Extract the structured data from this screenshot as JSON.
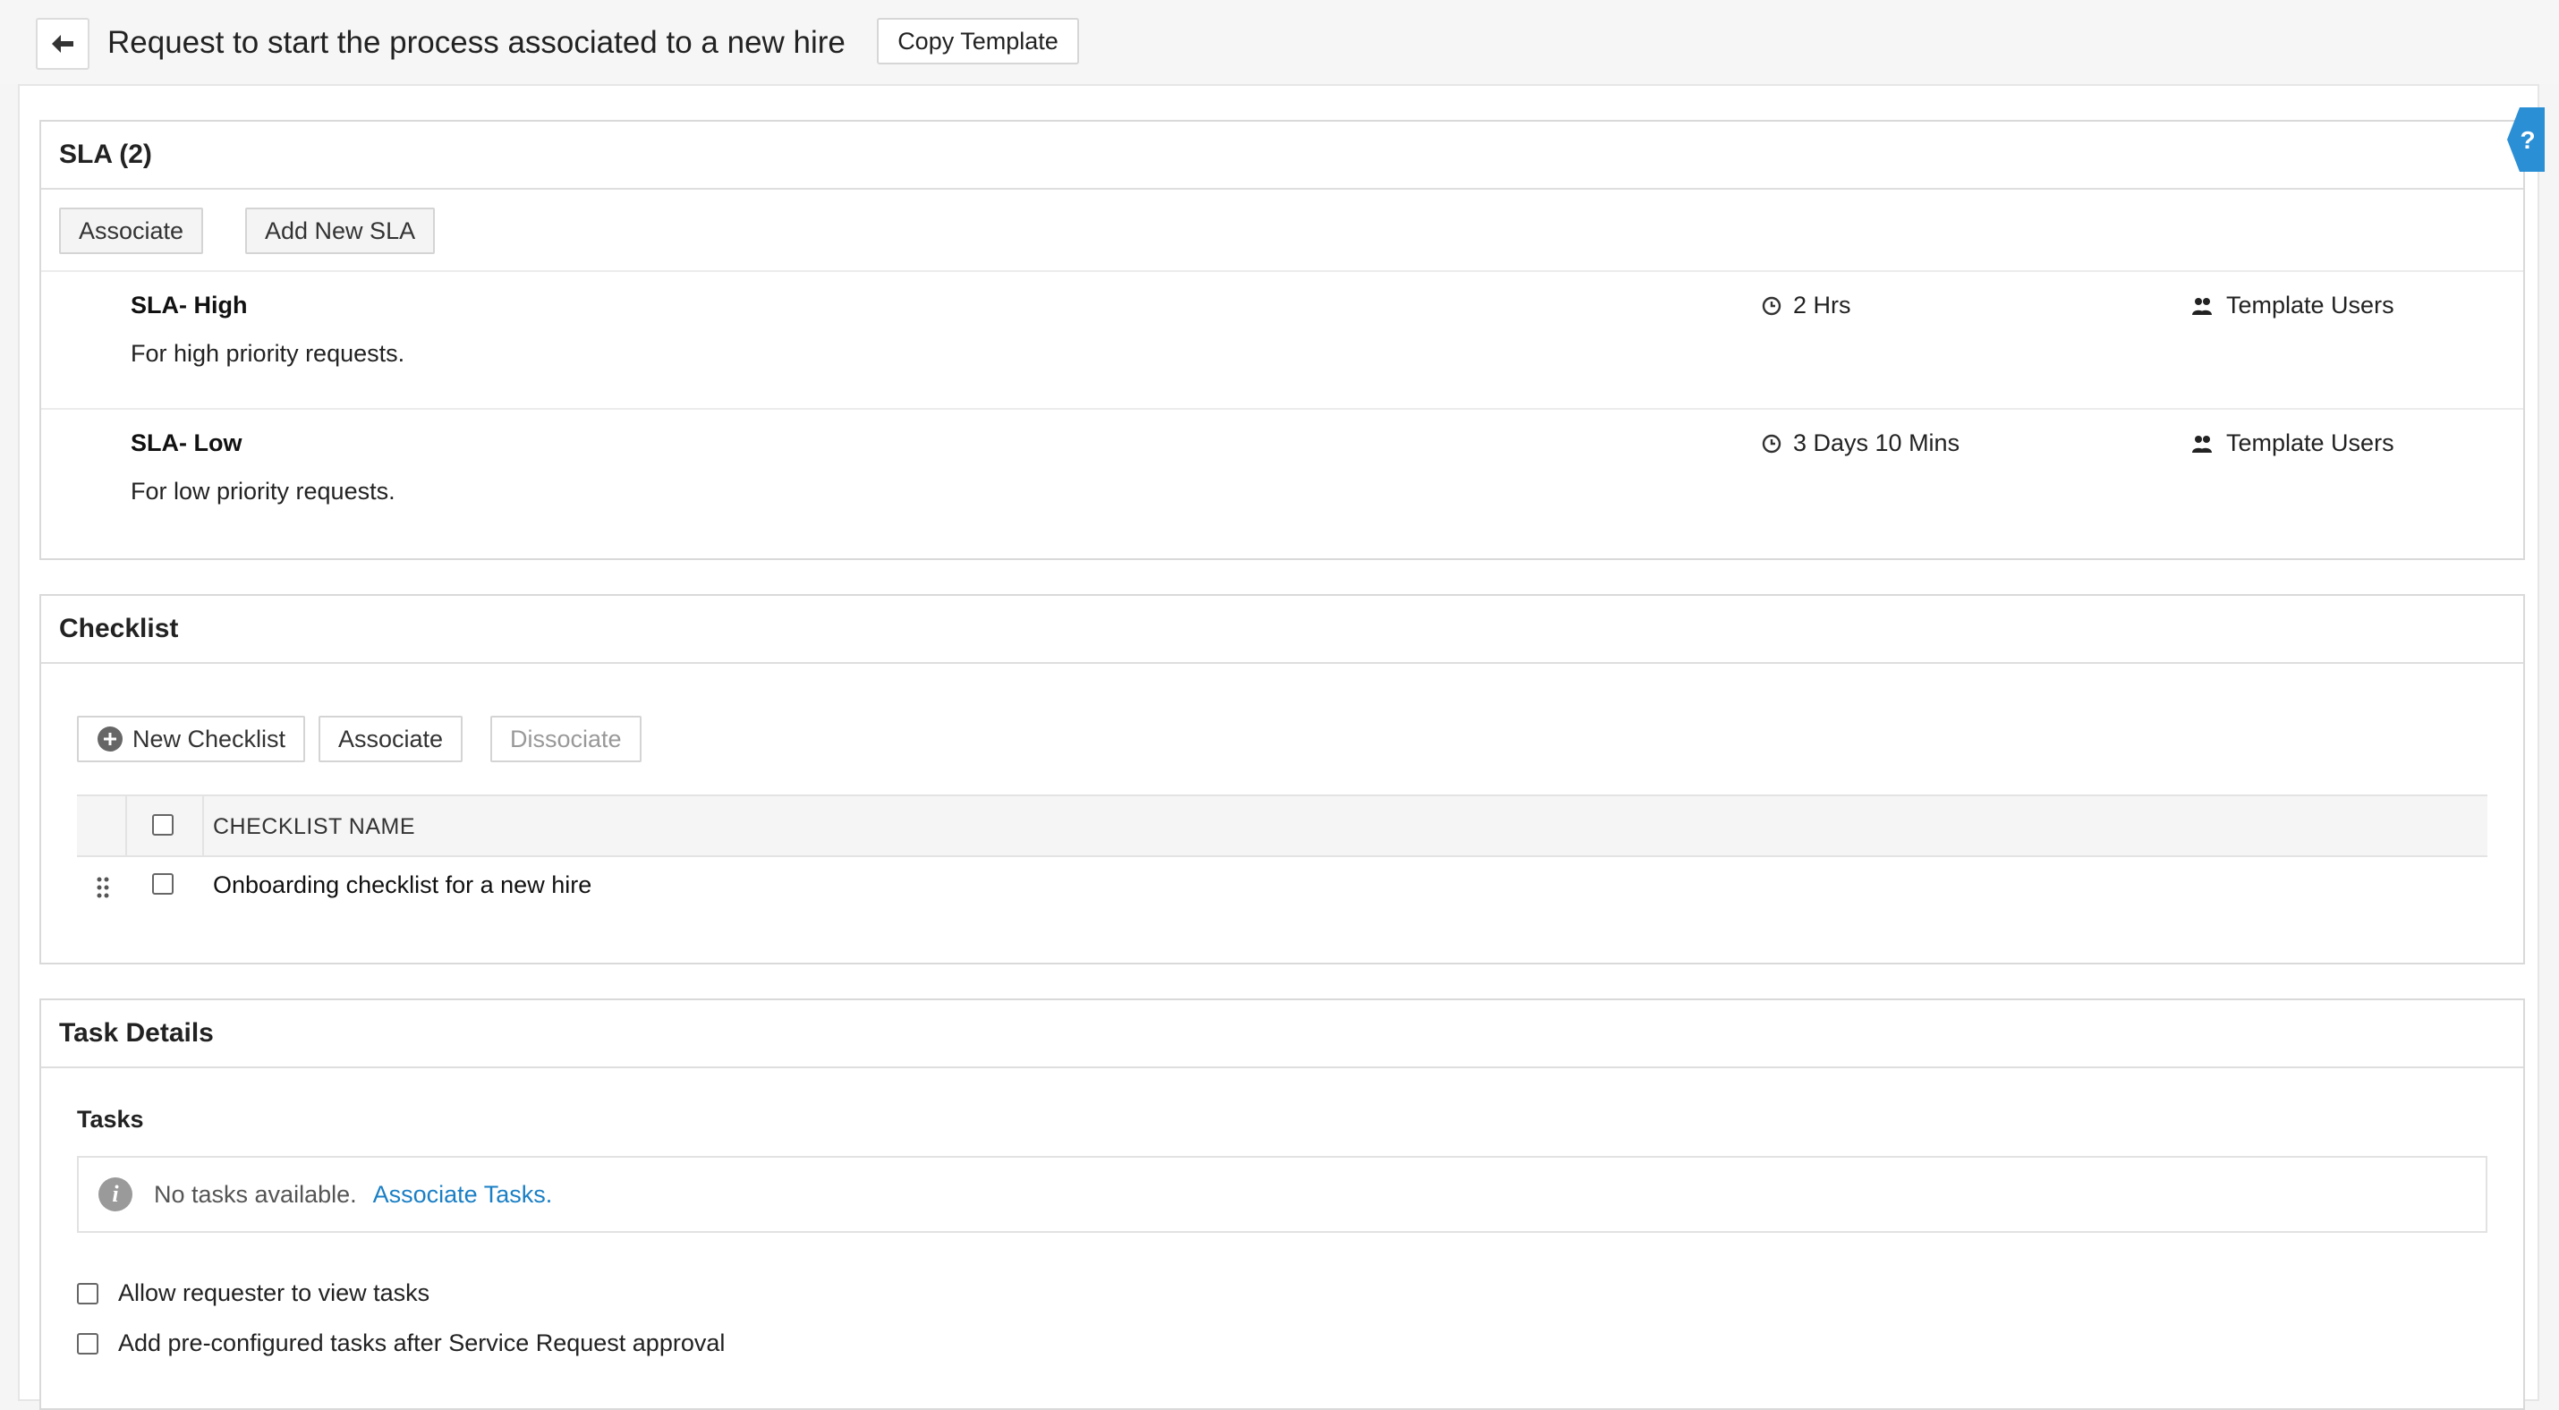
{
  "header": {
    "title": "Request to start the process associated to a new hire",
    "copy_template_label": "Copy Template"
  },
  "sla": {
    "heading": "SLA (2)",
    "associate_label": "Associate",
    "add_new_label": "Add New SLA",
    "items": [
      {
        "name": "SLA- High",
        "description": "For high priority requests.",
        "time": "2 Hrs",
        "users": "Template Users"
      },
      {
        "name": "SLA- Low",
        "description": "For low priority requests.",
        "time": "3 Days 10 Mins",
        "users": "Template Users"
      }
    ]
  },
  "checklist": {
    "heading": "Checklist",
    "new_checklist_label": "New Checklist",
    "associate_label": "Associate",
    "dissociate_label": "Dissociate",
    "column_name": "CHECKLIST NAME",
    "rows": [
      {
        "name": "Onboarding checklist for a new hire"
      }
    ]
  },
  "tasks": {
    "heading": "Task Details",
    "subheading": "Tasks",
    "empty_text": "No tasks available.",
    "associate_link": "Associate Tasks.",
    "options": [
      {
        "label": "Allow requester to view tasks",
        "checked": false
      },
      {
        "label": "Add pre-configured tasks after Service Request approval",
        "checked": false
      }
    ]
  },
  "colors": {
    "link": "#1a7fc4",
    "help_tab": "#2b8fd6"
  },
  "icons": {
    "back": "arrow-left-icon",
    "clock": "clock-icon",
    "users": "users-icon",
    "add": "plus-circle-icon",
    "drag": "drag-handle-icon",
    "info": "info-icon",
    "help": "help-icon"
  }
}
